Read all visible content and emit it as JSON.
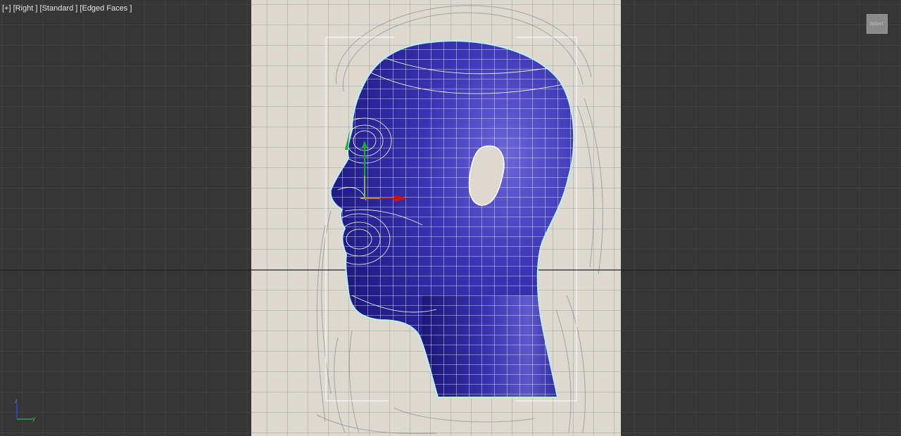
{
  "viewport": {
    "menu_plus": "[+]",
    "view_name": "[Right ]",
    "shading": "[Standard ]",
    "display_mode": "[Edged Faces ]"
  },
  "viewcube": {
    "label": "RIGHT"
  },
  "axis_tripod": {
    "z_label": "z",
    "y_label": "y"
  },
  "colors": {
    "viewport_bg": "#363636",
    "grid_line": "#4a4a4a",
    "reference_paper": "#ddd9d1",
    "mesh_fill": "#3a33b0",
    "wire_color": "#ffffff",
    "selection_outline": "#b8f0f0",
    "gizmo_x": "#d01010",
    "gizmo_y": "#10b020"
  },
  "icons": [
    "viewcube-icon",
    "axis-tripod-icon",
    "transform-gizmo-icon"
  ]
}
